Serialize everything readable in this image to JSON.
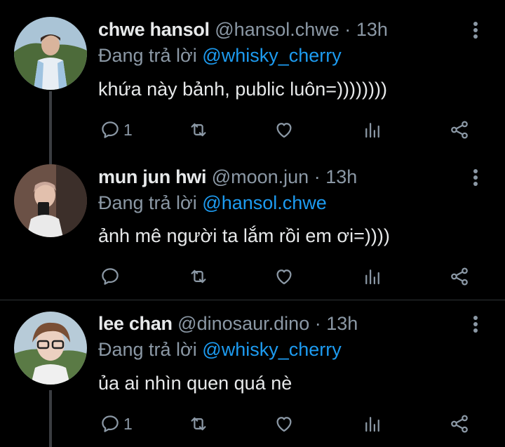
{
  "reply_prefix": "Đang trả lời",
  "tweets": [
    {
      "display_name": "chwe hansol",
      "handle": "@hansol.chwe",
      "dot": "·",
      "time": "13h",
      "reply_to": "@whisky_cherry",
      "text": "khứa này bảnh, public luôn=))))))))",
      "reply_count": "1"
    },
    {
      "display_name": "mun jun hwi",
      "handle": "@moon.jun",
      "dot": "·",
      "time": "13h",
      "reply_to": "@hansol.chwe",
      "text": "ảnh mê người ta lắm rồi em ơi=))))",
      "reply_count": ""
    },
    {
      "display_name": "lee chan",
      "handle": "@dinosaur.dino",
      "dot": "·",
      "time": "13h",
      "reply_to": "@whisky_cherry",
      "text": "ủa ai nhìn quen quá nè",
      "reply_count": "1"
    }
  ],
  "colors": {
    "background": "#000000",
    "text": "#e7e9ea",
    "muted": "#8b98a5",
    "mention": "#1d9bf0",
    "separator": "#2f3336"
  },
  "icons": [
    "reply-icon",
    "retweet-icon",
    "like-icon",
    "views-icon",
    "share-icon",
    "more-icon"
  ]
}
